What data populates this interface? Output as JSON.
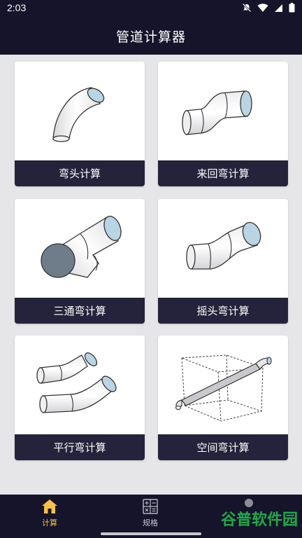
{
  "status_bar": {
    "time": "2:03",
    "icons": [
      "mute-icon",
      "wifi-icon",
      "signal-icon",
      "battery-icon"
    ]
  },
  "header": {
    "title": "管道计算器"
  },
  "cards": [
    {
      "label": "弯头计算",
      "icon": "elbow-pipe-icon"
    },
    {
      "label": "来回弯计算",
      "icon": "offset-pipe-icon"
    },
    {
      "label": "三通弯计算",
      "icon": "tee-pipe-icon"
    },
    {
      "label": "摇头弯计算",
      "icon": "rolling-offset-pipe-icon"
    },
    {
      "label": "平行弯计算",
      "icon": "parallel-pipe-icon"
    },
    {
      "label": "空间弯计算",
      "icon": "spatial-pipe-icon"
    }
  ],
  "bottom_nav": {
    "items": [
      {
        "label": "计算",
        "icon": "home-icon",
        "active": true
      },
      {
        "label": "规格",
        "icon": "calculator-icon",
        "active": false
      },
      {
        "label": "",
        "icon": "user-icon",
        "active": false
      }
    ]
  },
  "watermark": "谷普软件园",
  "colors": {
    "header_bg": "#15142a",
    "card_label_bg": "#24233b",
    "active_nav": "#f5c04a",
    "pipe_end": "#b9d4e3",
    "watermark": "#20a94a"
  }
}
